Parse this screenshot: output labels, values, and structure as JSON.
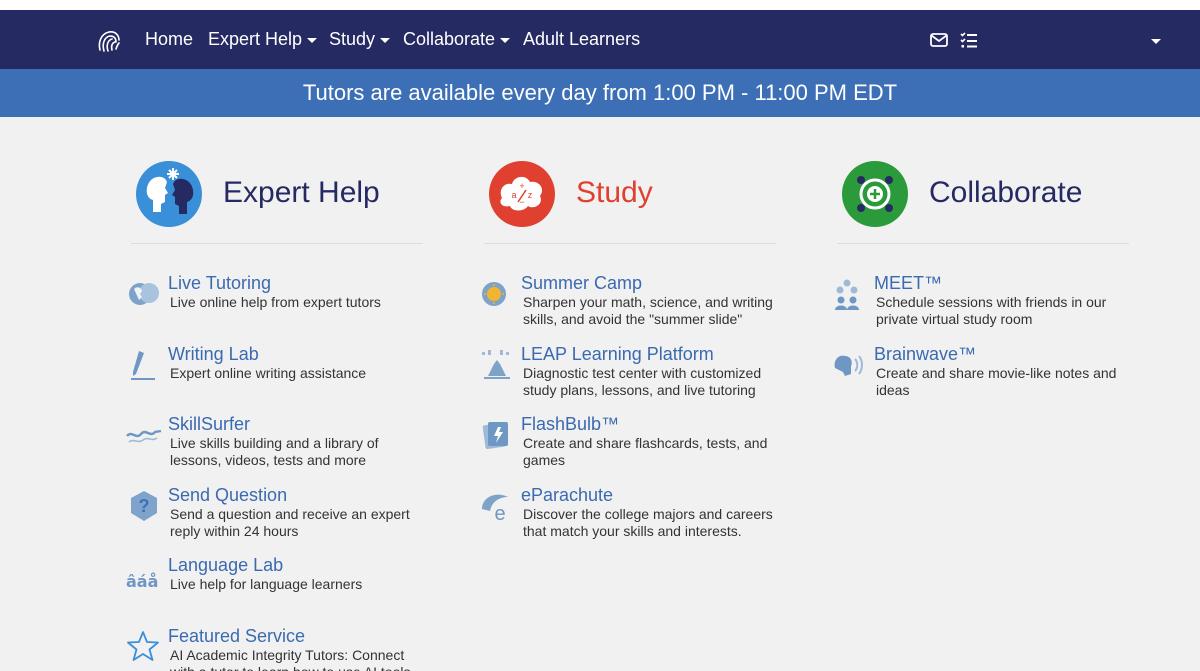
{
  "nav": {
    "items": [
      {
        "label": "Home",
        "caret": false
      },
      {
        "label": "Expert Help",
        "caret": true
      },
      {
        "label": "Study",
        "caret": true
      },
      {
        "label": "Collaborate",
        "caret": true
      },
      {
        "label": "Adult Learners",
        "caret": false
      }
    ],
    "icons": [
      "logo-icon",
      "mail-icon",
      "task-list-icon",
      "account-dropdown-caret"
    ]
  },
  "banner": {
    "text": "Tutors are available every day from 1:00 PM - 11:00 PM EDT"
  },
  "colors": {
    "navbar": "#262a62",
    "banner": "#3d6fb6",
    "link": "#3a6ab0",
    "expert": "#262a62",
    "study": "#e0402f",
    "collaborate": "#262a62"
  },
  "columns": [
    {
      "title": "Expert Help",
      "icon": "expert-help-icon",
      "items": [
        {
          "title": "Live Tutoring",
          "desc": "Live online help from expert tutors",
          "icon": "live-tutoring-icon"
        },
        {
          "title": "Writing Lab",
          "desc": "Expert online writing assistance",
          "icon": "writing-lab-icon"
        },
        {
          "title": "SkillSurfer",
          "desc": "Live skills building and a library of lessons, videos, tests and more",
          "icon": "skillsurfer-icon"
        },
        {
          "title": "Send Question",
          "desc": "Send a question and receive an expert reply within 24 hours",
          "icon": "send-question-icon"
        },
        {
          "title": "Language Lab",
          "desc": "Live help for language learners",
          "icon": "language-lab-icon"
        },
        {
          "title": "Featured Service",
          "desc": "AI Academic Integrity Tutors: Connect with a tutor to learn how to use AI tools",
          "icon": "star-icon"
        }
      ]
    },
    {
      "title": "Study",
      "icon": "study-icon",
      "items": [
        {
          "title": "Summer Camp",
          "desc": "Sharpen your math, science, and writing skills, and avoid the \"summer slide\"",
          "icon": "summer-camp-icon"
        },
        {
          "title": "LEAP Learning Platform",
          "desc": "Diagnostic test center with customized study plans, lessons, and live tutoring",
          "icon": "leap-icon"
        },
        {
          "title": "FlashBulb™",
          "desc": "Create and share flashcards, tests, and games",
          "icon": "flashbulb-icon"
        },
        {
          "title": "eParachute",
          "desc": "Discover the college majors and careers that match your skills and interests.",
          "icon": "eparachute-icon"
        }
      ]
    },
    {
      "title": "Collaborate",
      "icon": "collaborate-icon",
      "items": [
        {
          "title": "MEET™",
          "desc": "Schedule sessions with friends in our private virtual study room",
          "icon": "meet-icon"
        },
        {
          "title": "Brainwave™",
          "desc": "Create and share movie-like notes and ideas",
          "icon": "brainwave-icon"
        }
      ]
    }
  ]
}
